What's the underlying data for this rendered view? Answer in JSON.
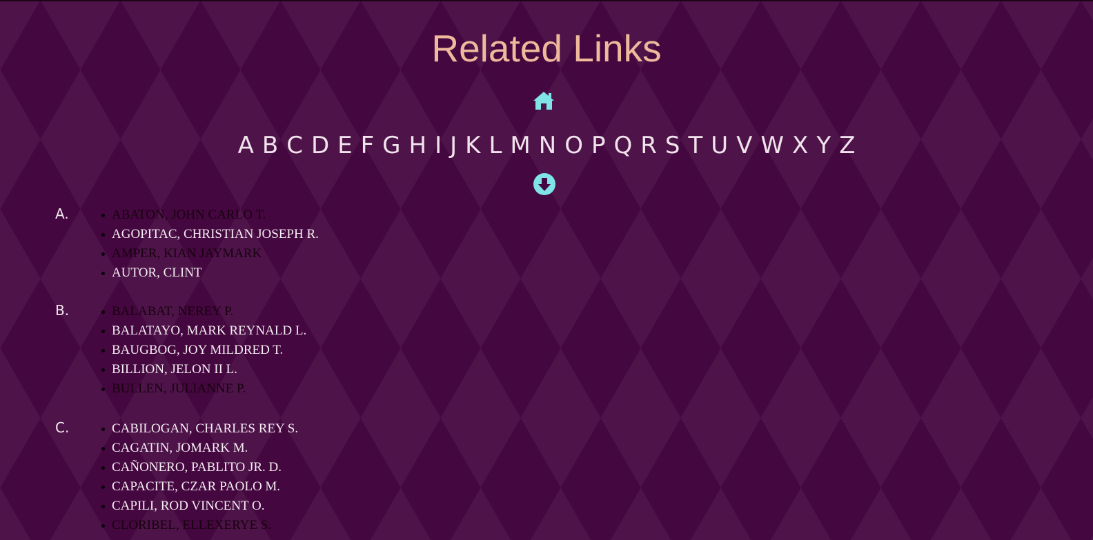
{
  "page": {
    "title": "Related Links",
    "home_icon": "home-icon",
    "down_icon": "arrow-circle-down-icon",
    "accent_color": "#7fe3e7",
    "title_color": "#efb99c",
    "background_color": "#44073f"
  },
  "alphabet": [
    "A",
    "B",
    "C",
    "D",
    "E",
    "F",
    "G",
    "H",
    "I",
    "J",
    "K",
    "L",
    "M",
    "N",
    "O",
    "P",
    "Q",
    "R",
    "S",
    "T",
    "U",
    "V",
    "W",
    "X",
    "Y",
    "Z"
  ],
  "sections": [
    {
      "letter": "A.",
      "names": [
        {
          "text": "ABATON, JOHN CARLO T.",
          "tone": "dark"
        },
        {
          "text": "AGOPITAC, CHRISTIAN JOSEPH R.",
          "tone": "light"
        },
        {
          "text": "AMPER, KIAN JAYMARK",
          "tone": "dark"
        },
        {
          "text": "AUTOR, CLINT",
          "tone": "light"
        }
      ]
    },
    {
      "letter": "B.",
      "names": [
        {
          "text": "BALABAT, NEREY P.",
          "tone": "dark"
        },
        {
          "text": "BALATAYO, MARK REYNALD L.",
          "tone": "light"
        },
        {
          "text": "BAUGBOG, JOY MILDRED T.",
          "tone": "light"
        },
        {
          "text": "BILLION, JELON II L.",
          "tone": "light"
        },
        {
          "text": "BULLEN, JULIANNE P.",
          "tone": "dark"
        }
      ]
    },
    {
      "letter": "C.",
      "names": [
        {
          "text": "CABILOGAN, CHARLES REY S.",
          "tone": "light"
        },
        {
          "text": "CAGATIN, JOMARK M.",
          "tone": "light"
        },
        {
          "text": "CAÑONERO, PABLITO JR. D.",
          "tone": "light"
        },
        {
          "text": "CAPACITE, CZAR PAOLO M.",
          "tone": "light"
        },
        {
          "text": "CAPILI, ROD VINCENT O.",
          "tone": "light"
        },
        {
          "text": "CLORIBEL, ELLEXERYE S.",
          "tone": "dark"
        }
      ]
    }
  ]
}
